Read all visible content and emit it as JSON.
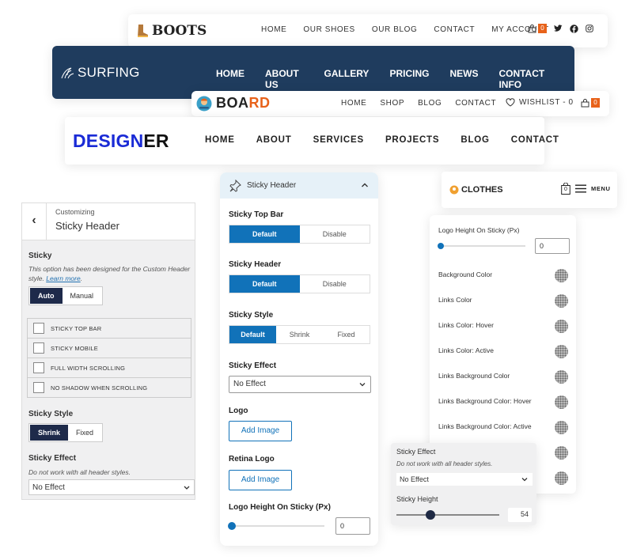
{
  "boots": {
    "logo": "BOOTS",
    "nav": [
      "HOME",
      "OUR SHOES",
      "OUR BLOG",
      "CONTACT",
      "MY ACCOUNT"
    ],
    "cart_count": "0"
  },
  "surfing": {
    "logo": "SURFING",
    "nav": [
      "HOME",
      "ABOUT US",
      "GALLERY",
      "PRICING",
      "NEWS",
      "CONTACT INFO"
    ]
  },
  "board": {
    "logo_part1": "BOA",
    "logo_part2": "RD",
    "nav": [
      "HOME",
      "SHOP",
      "BLOG",
      "CONTACT"
    ],
    "wishlist": "WISHLIST - 0",
    "cart_count": "0"
  },
  "designer": {
    "logo_part1": "DESIGN",
    "logo_part2": "ER",
    "nav": [
      "HOME",
      "ABOUT",
      "SERVICES",
      "PROJECTS",
      "BLOG",
      "CONTACT"
    ]
  },
  "customizer": {
    "back": "‹",
    "subtitle": "Customizing",
    "title": "Sticky Header",
    "sticky_label": "Sticky",
    "sticky_desc": "This option has been designed for the Custom Header style.",
    "learn_more": "Learn more",
    "sticky_options": [
      "Auto",
      "Manual"
    ],
    "checkboxes": [
      "STICKY TOP BAR",
      "STICKY MOBILE",
      "FULL WIDTH SCROLLING",
      "NO SHADOW WHEN SCROLLING"
    ],
    "style_label": "Sticky Style",
    "style_options": [
      "Shrink",
      "Fixed"
    ],
    "effect_label": "Sticky Effect",
    "effect_desc": "Do not work with all header styles.",
    "effect_value": "No Effect"
  },
  "center_panel": {
    "header": "Sticky Header",
    "top_bar_label": "Sticky Top Bar",
    "top_bar_options": [
      "Default",
      "Disable"
    ],
    "header_label": "Sticky Header",
    "header_options": [
      "Default",
      "Disable"
    ],
    "style_label": "Sticky Style",
    "style_options": [
      "Default",
      "Shrink",
      "Fixed"
    ],
    "effect_label": "Sticky Effect",
    "effect_value": "No Effect",
    "logo_label": "Logo",
    "logo_button": "Add Image",
    "retina_label": "Retina Logo",
    "retina_button": "Add Image",
    "height_label": "Logo Height On Sticky (Px)",
    "height_value": "0",
    "height_fraction": 0
  },
  "clothes": {
    "logo": "CLOTHES",
    "cart_count": "0",
    "menu": "MENU"
  },
  "colors_panel": {
    "height_label": "Logo Height On Sticky (Px)",
    "height_value": "0",
    "height_fraction": 0,
    "items": [
      "Background Color",
      "Links Color",
      "Links Color: Hover",
      "Links Color: Active",
      "Links Background Color",
      "Links Background Color: Hover",
      "Links Background Color: Active"
    ],
    "colors": {
      "accent": "#1172b9",
      "dark_nav": "#1f3c5e",
      "brand_orange": "#e8621a",
      "designer_blue": "#1a2bd6"
    }
  },
  "small_panel": {
    "effect_label": "Sticky Effect",
    "effect_desc": "Do not work with all header styles.",
    "effect_value": "No Effect",
    "height_label": "Sticky Height",
    "height_value": "54",
    "height_fraction": 0.33
  }
}
